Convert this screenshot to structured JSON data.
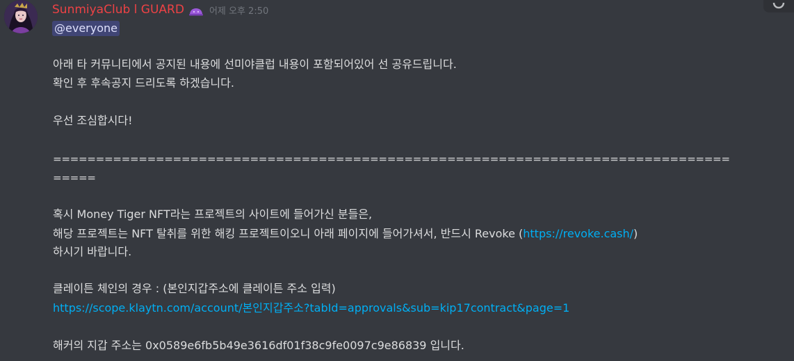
{
  "message": {
    "author": "SunmiyaClub l GUARD",
    "timestamp": "어제 오후 2:50",
    "mention": "@everyone",
    "line1": "아래 타 커뮤니티에서 공지된 내용에 선미야클럽 내용이 포함되어있어 선 공유드립니다.",
    "line2": "확인 후 후속공지 드리도록 하겠습니다.",
    "line3": "우선 조심합시다!",
    "divider_line1": "===============================================================================",
    "divider_line2": "=====",
    "line4": "혹시 Money Tiger NFT라는 프로젝트의 사이트에 들어가신 분들은,",
    "line5_prefix": "해당 프로젝트는 NFT 탈취를 위한 해킹 프로젝트이오니 아래 페이지에 들어가셔서, 반드시 Revoke (",
    "revoke_link": "https://revoke.cash/",
    "line5_suffix": ")",
    "line6": "하시기 바랍니다.",
    "line7": "클레이튼 체인의 경우 : (본인지갑주소에 클레이튼 주소 입력)",
    "scope_link_a": "https://scope.klaytn.com/account/",
    "scope_link_b": "본인지갑주소",
    "scope_link_c": "?tabId=approvals&sub=kip17contract&page=1",
    "line8": "해커의 지갑 주소는 0x0589e6fb5b49e3616df01f38c9fe0097c9e86839 입니다."
  },
  "colors": {
    "background": "#36393f",
    "username": "#ed4245",
    "text": "#dcddde",
    "link": "#00aff4",
    "timestamp": "#72767d",
    "mention_bg": "#5865f2"
  },
  "icons": {
    "avatar": "user-avatar-illustration",
    "role": "purple-role-badge-icon",
    "corner": "refresh-icon"
  }
}
